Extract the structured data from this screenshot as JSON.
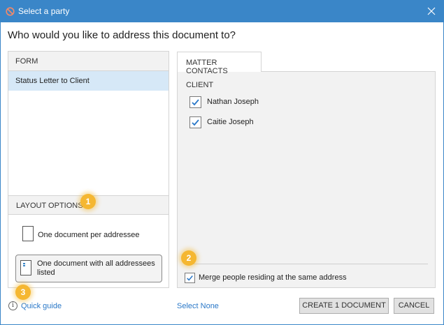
{
  "window": {
    "title": "Select a party",
    "icons": {
      "app": "app-logo-icon",
      "close": "close-icon"
    },
    "accent": "#3a86c8"
  },
  "heading": "Who would you like to address this document to?",
  "form_panel": {
    "header": "FORM",
    "items": [
      "Status Letter to Client"
    ],
    "selected": "Status Letter to Client"
  },
  "layout_options": {
    "header": "LAYOUT OPTIONS",
    "options": [
      {
        "label": "One document per addressee",
        "icon": "single-document-icon",
        "selected": false
      },
      {
        "label": "One document with all addressees listed",
        "icon": "list-document-icon",
        "selected": true
      }
    ]
  },
  "contacts": {
    "tab": "MATTER CONTACTS",
    "group": "CLIENT",
    "people": [
      {
        "name": "Nathan Joseph",
        "checked": true
      },
      {
        "name": "Caitie Joseph",
        "checked": true
      }
    ],
    "merge_label": "Merge people residing at the same address",
    "merge_checked": true
  },
  "badges": [
    "1",
    "2",
    "3"
  ],
  "badge_color": "#f5b731",
  "footer": {
    "quick_guide": "Quick guide",
    "info_icon": "info-icon",
    "info_glyph": "i",
    "select_none": "Select None",
    "create_button": "CREATE 1 DOCUMENT",
    "cancel_button": "CANCEL"
  }
}
